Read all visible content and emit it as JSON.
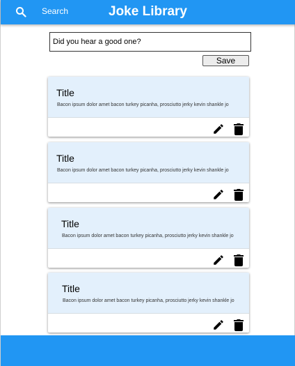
{
  "header": {
    "search_label": "Search",
    "title": "Joke Library",
    "search_icon": "search-icon",
    "background_color": "#2196f3"
  },
  "joke_form": {
    "placeholder": "Did you hear a good one?",
    "save_label": "Save"
  },
  "jokes": [
    {
      "title": "Title",
      "body": "Bacon ipsum dolor amet bacon turkey picanha, prosciutto jerky kevin shankle jo",
      "edit_icon": "edit-icon",
      "delete_icon": "delete-icon"
    },
    {
      "title": "Title",
      "body": "Bacon ipsum dolor amet bacon turkey picanha, prosciutto jerky kevin shankle jo",
      "edit_icon": "edit-icon",
      "delete_icon": "delete-icon"
    },
    {
      "title": "Title",
      "body": "Bacon ipsum dolor amet bacon turkey picanha, prosciutto jerky kevin shankle jo",
      "edit_icon": "edit-icon",
      "delete_icon": "delete-icon"
    },
    {
      "title": "Title",
      "body": "Bacon ipsum dolor amet bacon turkey picanha, prosciutto jerky kevin shankle jo",
      "edit_icon": "edit-icon",
      "delete_icon": "delete-icon"
    }
  ],
  "colors": {
    "primary": "#2196f3",
    "card_header": "#e3f0fc"
  }
}
